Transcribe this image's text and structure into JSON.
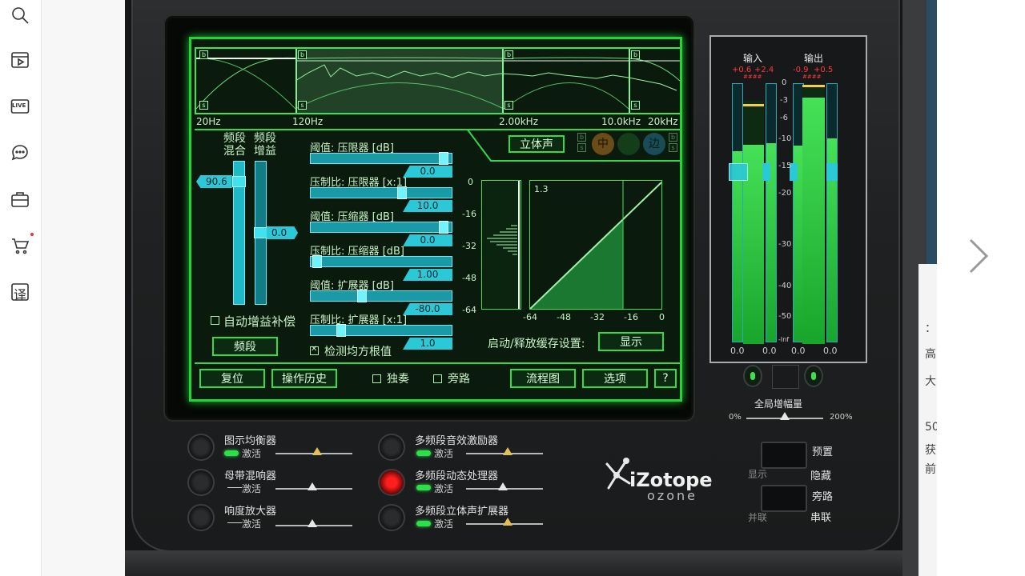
{
  "colors": {
    "screen_green": "#20d43a",
    "fader_cyan": "#2bc9d8",
    "red_knob": "#ff1d1d"
  },
  "sidebar": {
    "items": [
      {
        "icon": "search-icon"
      },
      {
        "icon": "video-icon"
      },
      {
        "icon": "live-icon",
        "label": "LIVE"
      },
      {
        "icon": "chat-icon"
      },
      {
        "icon": "briefcase-icon"
      },
      {
        "icon": "cart-icon"
      },
      {
        "icon": "translate-icon",
        "label": "译"
      }
    ]
  },
  "right_strip": {
    "chars": [
      "：",
      "高",
      "大",
      "50",
      "获",
      "前"
    ]
  },
  "spectrum": {
    "freq_labels": [
      "20Hz",
      "120Hz",
      "2.00kHz",
      "10.0kHz",
      "20kHz"
    ],
    "band_b": "b",
    "band_s": "s"
  },
  "band_controls": {
    "mix_label": "频段\n混合",
    "gain_label": "频段\n增益",
    "mix_value": "90.6",
    "gain_value": "0.0",
    "auto_gain": "自动增益补偿",
    "bands_button": "频段",
    "stereo_button": "立体声",
    "mid_label": "中",
    "side_label": "边"
  },
  "dynamics": {
    "params": [
      {
        "label": "阈值: 压限器 [dB]",
        "value": "0.0",
        "pos": 0.95
      },
      {
        "label": "压制比: 压限器 [x:1]",
        "value": "10.0",
        "pos": 0.63
      },
      {
        "label": "阈值: 压缩器 [dB]",
        "value": "0.0",
        "pos": 0.95
      },
      {
        "label": "压制比: 压缩器 [dB]",
        "value": "1.00",
        "pos": 0.04
      },
      {
        "label": "阈值: 扩展器 [dB]",
        "value": "-80.0",
        "pos": 0.36
      },
      {
        "label": "压制比: 扩展器 [x:1]",
        "value": "1.0",
        "pos": 0.22
      }
    ],
    "rms_detect": "检测均方根值",
    "graph_ratio": "1.3",
    "y_ticks": [
      "0",
      "-16",
      "-32",
      "-48",
      "-64"
    ],
    "x_ticks": [
      "-64",
      "-48",
      "-32",
      "-16",
      "0"
    ],
    "attack_release": "启动/释放缓存设置:",
    "show_button": "显示"
  },
  "footer_buttons": {
    "reset": "复位",
    "history": "操作历史",
    "solo": "独奏",
    "bypass": "旁路",
    "graph": "流程图",
    "options": "选项",
    "help": "?"
  },
  "meters": {
    "input_label": "输入",
    "output_label": "输出",
    "input_peaks": [
      "+0.6",
      "+2.4"
    ],
    "output_peaks": [
      "-0.9",
      "+0.5"
    ],
    "clip_text": "####",
    "scale": [
      "0",
      "-3",
      "-6",
      "-10",
      "-15",
      "-20",
      "-30",
      "-40",
      "-50",
      "-Inf"
    ],
    "readouts": [
      "0.0",
      "0.0",
      "0.0",
      "0.0"
    ],
    "input_levels": [
      0.74,
      0.77
    ],
    "output_levels": [
      0.76,
      0.79
    ],
    "global_gain_label": "全局增幅量",
    "global_min": "0%",
    "global_max": "200%"
  },
  "modules": [
    {
      "title": "图示均衡器",
      "sub": "激活",
      "active": true,
      "knob": "off"
    },
    {
      "title": "母带混响器",
      "sub": "激活",
      "active": false,
      "knob": "off"
    },
    {
      "title": "响度放大器",
      "sub": "激活",
      "active": false,
      "knob": "off"
    },
    {
      "title": "多频段音效激励器",
      "sub": "激活",
      "active": true,
      "knob": "off"
    },
    {
      "title": "多频段动态处理器",
      "sub": "激活",
      "active": true,
      "knob": "on"
    },
    {
      "title": "多频段立体声扩展器",
      "sub": "激活",
      "active": true,
      "knob": "off"
    }
  ],
  "brand": {
    "name": "iZotope",
    "product": "ozone"
  },
  "routing": {
    "preset": "预置",
    "display": "显示",
    "mute": "隐藏",
    "bypass": "旁路",
    "parallel": "并联",
    "serial": "串联"
  }
}
